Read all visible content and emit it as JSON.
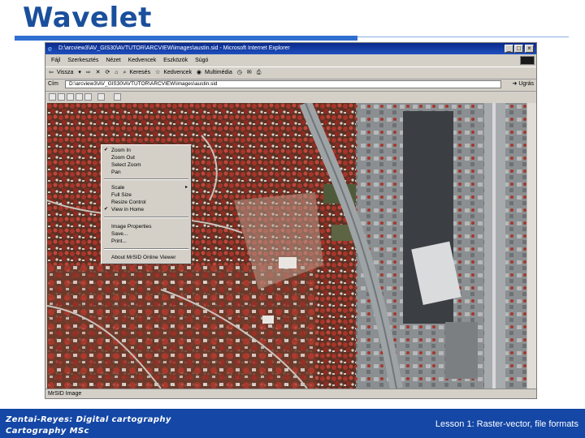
{
  "slide": {
    "title": "Wavelet"
  },
  "window": {
    "title": "D:\\arcview3\\AV_GIS30\\AVTUTOR\\ARCVIEW\\images\\austin.sid - Microsoft Internet Explorer",
    "menu": [
      "Fájl",
      "Szerkesztés",
      "Nézet",
      "Kedvencek",
      "Eszközök",
      "Súgó"
    ],
    "toolbar": {
      "back": "Vissza",
      "search": "Keresés",
      "favorites": "Kedvencek",
      "media": "Multimédia"
    },
    "address": {
      "label": "Cím",
      "value": "D:\\arcview3\\AV_GIS30\\AVTUTOR\\ARCVIEW\\images\\austin.sid",
      "go": "Ugrás"
    },
    "status": "MrSID Image"
  },
  "context_menu": {
    "items": [
      {
        "label": "Zoom In",
        "checked": true
      },
      {
        "label": "Zoom Out"
      },
      {
        "label": "Select Zoom"
      },
      {
        "label": "Pan"
      },
      {
        "separator": true
      },
      {
        "label": "Scale",
        "submenu": true
      },
      {
        "label": "Full Size"
      },
      {
        "label": "Resize Control"
      },
      {
        "label": "View in Home",
        "checked": true
      },
      {
        "separator": true
      },
      {
        "label": "Image Properties"
      },
      {
        "label": "Save..."
      },
      {
        "label": "Print..."
      },
      {
        "separator": true
      },
      {
        "label": "About MrSID Online Viewer"
      }
    ]
  },
  "footer": {
    "left_line1": "Zentai-Reyes: Digital cartography",
    "left_line2": "Cartography MSc",
    "right": "Lesson 1: Raster-vector, file formats"
  },
  "colors": {
    "title": "#1a4f9c",
    "footer_bg": "#1447a6",
    "window_chrome": "#d4d0c8",
    "vegetation": "#b2322a",
    "urban": "#8a8f92"
  }
}
